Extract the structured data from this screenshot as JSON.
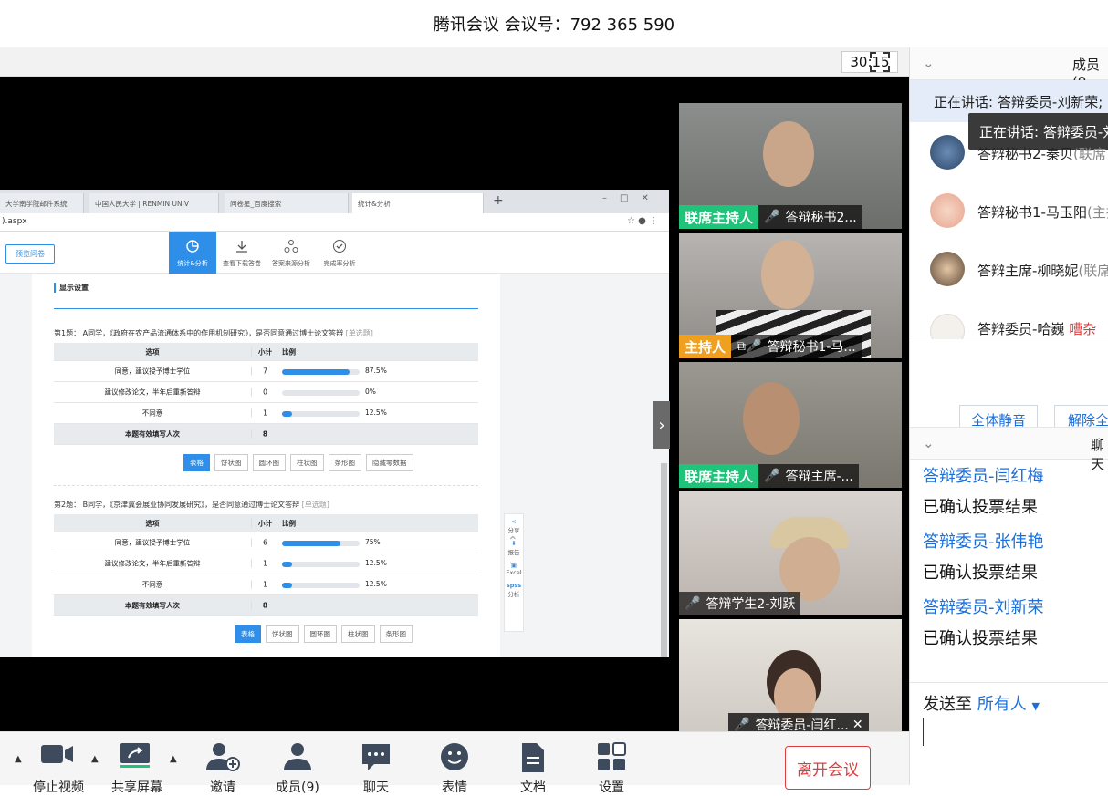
{
  "window": {
    "title": "腾讯会议 会议号：792 365 590"
  },
  "top_bar": {
    "timer": "30:15"
  },
  "browser": {
    "tabs": [
      "大学南学院邮件系统",
      "中国人民大学 | RENMIN UNIV",
      "问卷星_百度搜索",
      "统计&分析"
    ],
    "address": ").aspx"
  },
  "survey": {
    "preview_button": "预览问卷",
    "tools": [
      "统计&分析",
      "查看下载答卷",
      "答案来源分析",
      "完成率分析"
    ],
    "section_title": "显示设置",
    "table_headers": {
      "option": "选项",
      "count": "小计",
      "ratio": "比例"
    },
    "questions": [
      {
        "title": "第1题：  A同学，《政府在农产品流通体系中的作用机制研究》，是否同意通过博士论文答辩",
        "type_tag": "[单选题]",
        "rows": [
          {
            "option": "同意，建议授予博士学位",
            "count": "7",
            "percent": "87.5%",
            "fraction": 0.875
          },
          {
            "option": "建议修改论文，半年后重新答辩",
            "count": "0",
            "percent": "0%",
            "fraction": 0
          },
          {
            "option": "不同意",
            "count": "1",
            "percent": "12.5%",
            "fraction": 0.125
          }
        ],
        "total_label": "本题有效填写人次",
        "total": "8",
        "buttons": [
          "表格",
          "饼状图",
          "圆环图",
          "柱状图",
          "条形图",
          "隐藏零数据"
        ]
      },
      {
        "title": "第2题：  B同学，《京津冀会展业协同发展研究》，是否同意通过博士论文答辩",
        "type_tag": "[单选题]",
        "rows": [
          {
            "option": "同意，建议授予博士学位",
            "count": "6",
            "percent": "75%",
            "fraction": 0.75
          },
          {
            "option": "建议修改论文，半年后重新答辩",
            "count": "1",
            "percent": "12.5%",
            "fraction": 0.125
          },
          {
            "option": "不同意",
            "count": "1",
            "percent": "12.5%",
            "fraction": 0.125
          }
        ],
        "total_label": "本题有效填写人次",
        "total": "8",
        "buttons": [
          "表格",
          "饼状图",
          "圆环图",
          "柱状图",
          "条形图"
        ]
      }
    ],
    "side_tools": [
      "分享",
      "报告",
      "Excel",
      "spss",
      "分析"
    ]
  },
  "videos": [
    {
      "tag": "联席主持人",
      "name": "答辩秘书2..."
    },
    {
      "tag": "主持人",
      "name": "答辩秘书1-马..."
    },
    {
      "tag": "联席主持人",
      "name": "答辩主席-..."
    },
    {
      "tag": "",
      "name": "答辩学生2-刘跃"
    },
    {
      "tag": "",
      "name": "答辩委员-闫红..."
    }
  ],
  "members_panel": {
    "title": "成员(9",
    "speaking": "正在讲话: 答辩委员-刘新荣;",
    "tooltip": "正在讲话: 答辩委员-刘",
    "members": [
      {
        "name": "答辩秘书2-秦贝",
        "role": "(联席"
      },
      {
        "name": "答辩秘书1-马玉阳",
        "role": "(主持"
      },
      {
        "name": "答辩主席-柳晓妮",
        "role": "(联席"
      },
      {
        "name": "答辩委员-哈巍",
        "role": "嘈杂"
      }
    ],
    "mute_all": "全体静音",
    "unmute_all": "解除全"
  },
  "chat_panel": {
    "title": "聊天",
    "messages": [
      {
        "sender": "答辩委员-闫红梅",
        "text": "已确认投票结果"
      },
      {
        "sender": "答辩委员-张伟艳",
        "text": "已确认投票结果"
      },
      {
        "sender": "答辩委员-刘新荣",
        "text": "已确认投票结果"
      }
    ],
    "send_to_label": "发送至",
    "send_to_value": "所有人"
  },
  "toolbar": {
    "items": [
      "停止视频",
      "共享屏幕",
      "邀请",
      "成员(9)",
      "聊天",
      "表情",
      "文档",
      "设置"
    ],
    "leave": "离开会议"
  },
  "colors": {
    "accent": "#2f8fe8",
    "host_green": "#1fc37a",
    "host_orange": "#f0a021",
    "link_blue": "#1a6fd8",
    "leave_red": "#e03c3c"
  }
}
